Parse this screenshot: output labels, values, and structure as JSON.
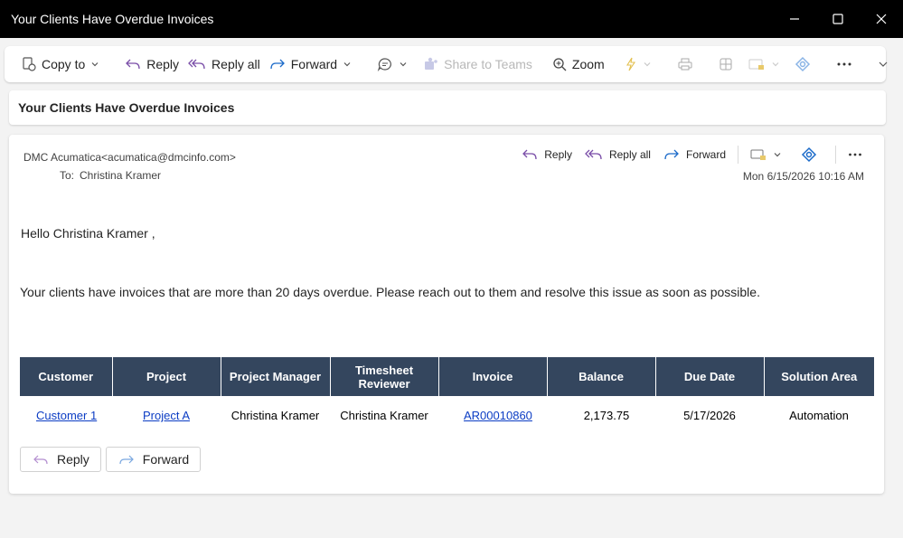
{
  "window": {
    "title": "Your Clients Have Overdue Invoices"
  },
  "toolbar": {
    "copy_to": "Copy to",
    "reply": "Reply",
    "reply_all": "Reply all",
    "forward": "Forward",
    "share_to_teams": "Share to Teams",
    "zoom": "Zoom"
  },
  "subject": "Your Clients Have Overdue Invoices",
  "message": {
    "from": "DMC Acumatica<acumatica@dmcinfo.com>",
    "to_label": "To:",
    "to": "Christina Kramer",
    "date": "Mon 6/15/2026 10:16 AM",
    "actions": {
      "reply": "Reply",
      "reply_all": "Reply all",
      "forward": "Forward"
    },
    "greeting": "Hello  Christina Kramer ,",
    "intro": "Your clients have invoices that are more than 20 days overdue. Please reach out to them and resolve this issue as soon as possible.",
    "table": {
      "headers": [
        "Customer",
        "Project",
        "Project Manager",
        "Timesheet Reviewer",
        "Invoice",
        "Balance",
        "Due Date",
        "Solution Area"
      ],
      "rows": [
        {
          "customer": "Customer 1",
          "project": "Project A",
          "project_manager": "Christina Kramer",
          "timesheet_reviewer": "Christina Kramer",
          "invoice": "AR00010860",
          "balance": "2,173.75",
          "due_date": "5/17/2026",
          "solution_area": "Automation"
        }
      ]
    },
    "bottom_buttons": {
      "reply": "Reply",
      "forward": "Forward"
    }
  },
  "colors": {
    "titlebar": "#000000",
    "table_header": "#34465e",
    "link": "#0b3cc4",
    "icon_purple": "#7a4ea8",
    "icon_blue": "#1b6ac9"
  }
}
